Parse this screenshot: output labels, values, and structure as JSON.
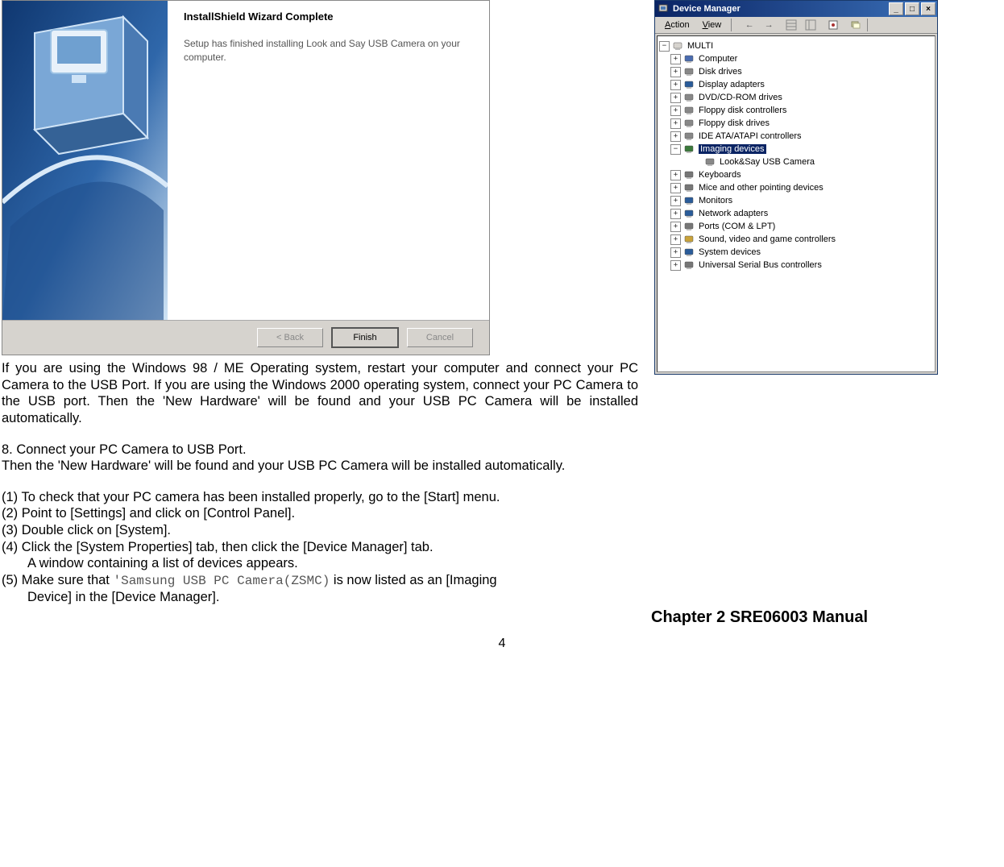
{
  "wizard": {
    "title": "InstallShield Wizard Complete",
    "text": "Setup has finished installing Look and Say USB Camera on your computer.",
    "buttons": {
      "back": "< Back",
      "finish": "Finish",
      "cancel": "Cancel"
    }
  },
  "doc": {
    "para1": "If you are using the Windows 98 / ME Operating system, restart your computer and connect your PC Camera to the USB Port. If you are using the Windows 2000 operating system, connect your PC Camera to the USB port. Then the 'New Hardware' will be found and your USB PC Camera will be installed automatically.",
    "step8_head": "8. Connect your PC Camera to USB Port.",
    "step8_text": "Then the 'New Hardware' will be found and your USB PC Camera will be installed automatically.",
    "s1": "(1) To check that your PC camera has been installed properly, go to the [Start] menu.",
    "s2": "(2) Point to [Settings] and click on [Control Panel].",
    "s3": "(3) Double click on [System].",
    "s4": "(4) Click the [System Properties] tab, then click the [Device Manager] tab.",
    "s4b": "A window containing a list of devices appears.",
    "s5a": "(5) Make sure that",
    "s5mono": "'Samsung USB PC Camera(ZSMC)",
    "s5b": " is now listed as an [Imaging",
    "s5c": "Device] in the [Device Manager].",
    "page_num": "4"
  },
  "dm": {
    "title": "Device Manager",
    "menu": {
      "action": "Action",
      "view": "View"
    },
    "root": "MULTI",
    "nodes": [
      {
        "label": "Computer",
        "exp": "+",
        "icon": "#4a6cb0"
      },
      {
        "label": "Disk drives",
        "exp": "+",
        "icon": "#888"
      },
      {
        "label": "Display adapters",
        "exp": "+",
        "icon": "#2a5c9a"
      },
      {
        "label": "DVD/CD-ROM drives",
        "exp": "+",
        "icon": "#888"
      },
      {
        "label": "Floppy disk controllers",
        "exp": "+",
        "icon": "#888"
      },
      {
        "label": "Floppy disk drives",
        "exp": "+",
        "icon": "#888"
      },
      {
        "label": "IDE ATA/ATAPI controllers",
        "exp": "+",
        "icon": "#888"
      },
      {
        "label": "Imaging devices",
        "exp": "−",
        "icon": "#3a7a3a",
        "selected": true,
        "children": [
          {
            "label": "Look&Say USB Camera",
            "icon": "#888"
          }
        ]
      },
      {
        "label": "Keyboards",
        "exp": "+",
        "icon": "#777"
      },
      {
        "label": "Mice and other pointing devices",
        "exp": "+",
        "icon": "#777"
      },
      {
        "label": "Monitors",
        "exp": "+",
        "icon": "#2a5c9a"
      },
      {
        "label": "Network adapters",
        "exp": "+",
        "icon": "#2a5c9a"
      },
      {
        "label": "Ports (COM & LPT)",
        "exp": "+",
        "icon": "#777"
      },
      {
        "label": "Sound, video and game controllers",
        "exp": "+",
        "icon": "#caa33a"
      },
      {
        "label": "System devices",
        "exp": "+",
        "icon": "#2a5c9a"
      },
      {
        "label": "Universal Serial Bus controllers",
        "exp": "+",
        "icon": "#777"
      }
    ]
  },
  "chapter": "Chapter 2  SRE06003 Manual"
}
